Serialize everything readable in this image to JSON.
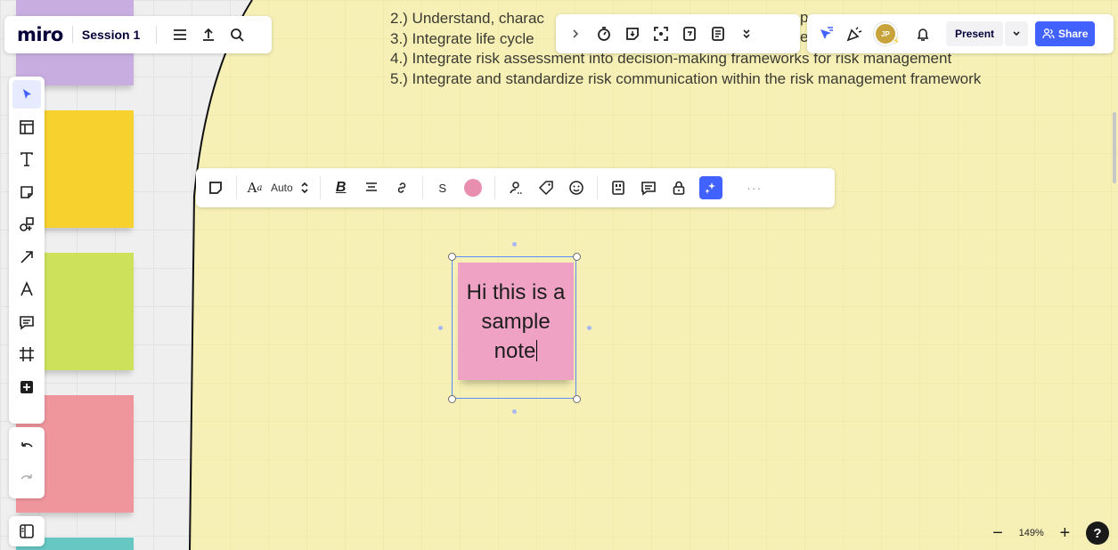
{
  "colors": {
    "board_yellow": "#f7f0b6",
    "note_pink": "#efa2c4",
    "accent_blue": "#4262ff",
    "sticky_purple": "#c8aee0",
    "sticky_yellow": "#f7d12d",
    "sticky_green": "#cde25a",
    "sticky_red": "#ef959c",
    "sticky_teal": "#66c7c3"
  },
  "header": {
    "logo": "miro",
    "board_name": "Session 1",
    "icons": [
      "menu-icon",
      "upload-icon",
      "search-icon"
    ]
  },
  "top_center_toolbar": {
    "icons": [
      "chevron-right-icon",
      "timer-icon",
      "sticky-export-icon",
      "focus-icon",
      "voting-icon",
      "notes-icon",
      "double-chevron-icon"
    ]
  },
  "top_right_toolbar": {
    "avatar_initials": "JP",
    "present_label": "Present",
    "share_label": "Share"
  },
  "board_text": {
    "lines": [
      "2.) Understand, charac",
      "3.) Integrate life cycle",
      "4.) Integrate risk assessment into decision-making frameworks for risk management",
      "5.) Integrate and standardize risk communication within the risk management framework"
    ],
    "fragment_behind_toolbar_1": "p",
    "fragment_behind_toolbar_2": "el"
  },
  "left_toolbar": {
    "tools": [
      "select-icon",
      "templates-icon",
      "text-icon",
      "sticky-note-icon",
      "shapes-icon",
      "arrow-icon",
      "pen-icon",
      "comment-icon",
      "frame-icon",
      "add-icon"
    ]
  },
  "context_toolbar": {
    "font_size_label": "Auto",
    "size_label": "S",
    "sticky_color": "#e88fb0",
    "more_label": "···"
  },
  "sticky_note": {
    "text": "Hi this is a sample note"
  },
  "zoom": {
    "level": "149%",
    "minus": "−",
    "plus": "+",
    "help": "?"
  }
}
